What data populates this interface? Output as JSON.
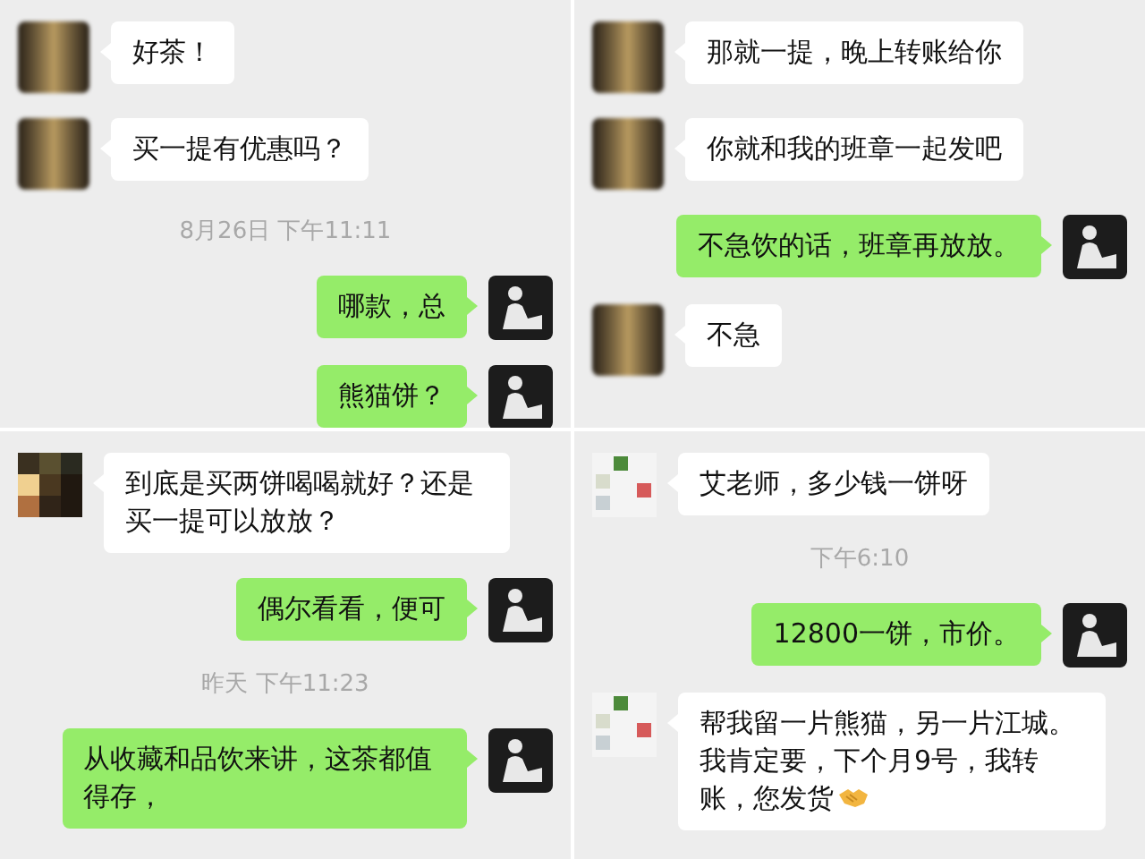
{
  "panels": [
    {
      "avatar": {
        "kind": "blurred"
      },
      "messages": [
        {
          "kind": "incoming",
          "text": "好茶！"
        },
        {
          "kind": "incoming",
          "text": "买一提有优惠吗？"
        },
        {
          "kind": "time",
          "text": "8月26日 下午11:11"
        },
        {
          "kind": "outgoing",
          "text": "哪款，总"
        },
        {
          "kind": "outgoing",
          "text": "熊猫饼？"
        }
      ]
    },
    {
      "avatar": {
        "kind": "blurred"
      },
      "messages": [
        {
          "kind": "incoming",
          "text": "那就一提，晚上转账给你"
        },
        {
          "kind": "incoming",
          "text": "你就和我的班章一起发吧"
        },
        {
          "kind": "outgoing",
          "text": "不急饮的话，班章再放放。"
        },
        {
          "kind": "incoming",
          "text": "不急"
        }
      ]
    },
    {
      "avatar": {
        "kind": "mosaic"
      },
      "messages": [
        {
          "kind": "incoming",
          "text": "到底是买两饼喝喝就好？还是买一提可以放放？"
        },
        {
          "kind": "outgoing",
          "text": "偶尔看看，便可"
        },
        {
          "kind": "time",
          "text": "昨天 下午11:23"
        },
        {
          "kind": "outgoing",
          "text": "从收藏和品饮来讲，这茶都值得存，"
        }
      ]
    },
    {
      "avatar": {
        "kind": "squares"
      },
      "messages": [
        {
          "kind": "incoming",
          "text": "艾老师，多少钱一饼呀"
        },
        {
          "kind": "time",
          "text": "下午6:10"
        },
        {
          "kind": "outgoing",
          "text": "12800一饼，市价。"
        },
        {
          "kind": "incoming",
          "text": "帮我留一片熊猫，另一片江城。我肯定要，下个月9号，我转账，您发货",
          "trailing_icon": {
            "kind": "handshake"
          }
        }
      ]
    }
  ]
}
